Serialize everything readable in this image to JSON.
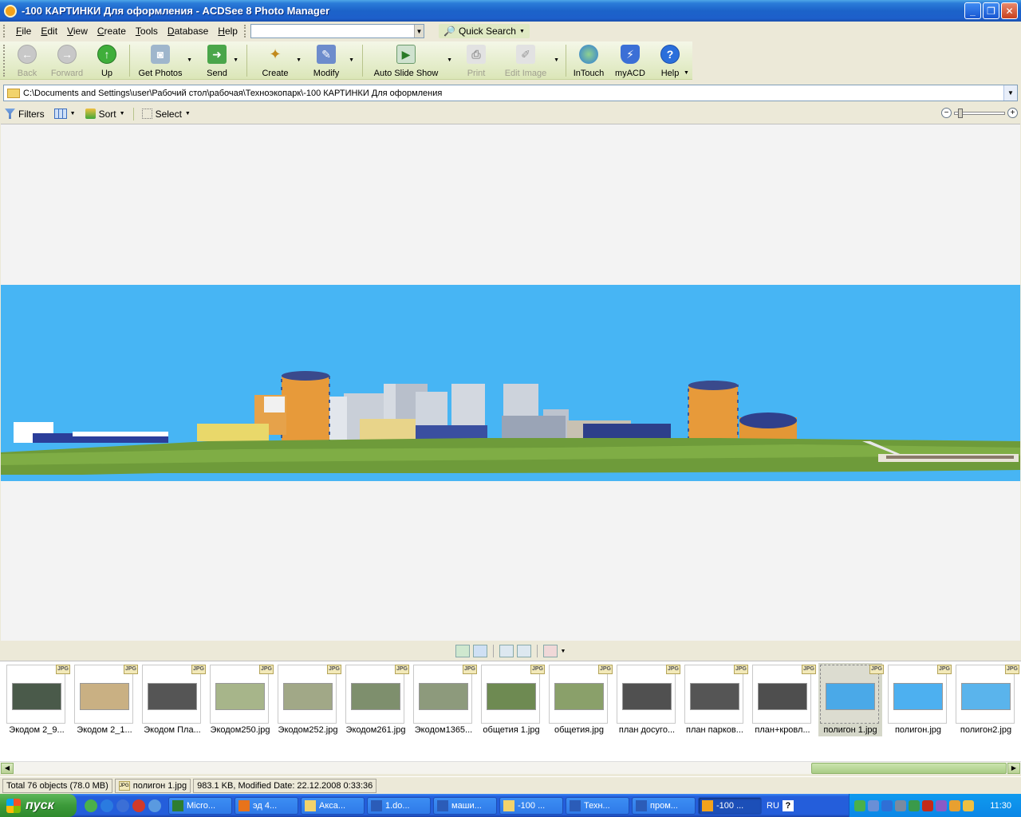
{
  "window": {
    "title": "-100 КАРТИНКИ  Для оформления - ACDSee 8 Photo Manager",
    "buttons": {
      "minimize": "_",
      "maximize": "❐",
      "close": "✕"
    }
  },
  "menu": {
    "items": [
      "File",
      "Edit",
      "View",
      "Create",
      "Tools",
      "Database",
      "Help"
    ],
    "search_value": "",
    "quick_search_label": "Quick Search"
  },
  "toolbar": {
    "buttons": [
      {
        "label": "Back",
        "icon": "back-arrow-icon",
        "enabled": false
      },
      {
        "label": "Forward",
        "icon": "forward-arrow-icon",
        "enabled": false
      },
      {
        "label": "Up",
        "icon": "up-arrow-icon",
        "enabled": true
      },
      {
        "label": "Get Photos",
        "icon": "camera-icon",
        "enabled": true
      },
      {
        "label": "Send",
        "icon": "send-icon",
        "enabled": true
      },
      {
        "label": "Create",
        "icon": "magic-wand-icon",
        "enabled": true
      },
      {
        "label": "Modify",
        "icon": "modify-icon",
        "enabled": true
      },
      {
        "label": "Auto Slide Show",
        "icon": "slideshow-icon",
        "enabled": true
      },
      {
        "label": "Print",
        "icon": "printer-icon",
        "enabled": false
      },
      {
        "label": "Edit Image",
        "icon": "edit-image-icon",
        "enabled": false
      },
      {
        "label": "InTouch",
        "icon": "globe-icon",
        "enabled": true
      },
      {
        "label": "myACD",
        "icon": "myacd-icon",
        "enabled": true
      },
      {
        "label": "Help",
        "icon": "help-icon",
        "enabled": true
      }
    ]
  },
  "address": {
    "path": "C:\\Documents and Settings\\user\\Рабочий стол\\рабочая\\Техноэкопарк\\-100 КАРТИНКИ  Для оформления"
  },
  "filterbar": {
    "filters_label": "Filters",
    "sort_label": "Sort",
    "select_label": "Select"
  },
  "filmstrip": {
    "badge": "JPG",
    "items": [
      {
        "name": "Экодом 2_9...",
        "color": "#4a5a4a"
      },
      {
        "name": "Экодом 2_1...",
        "color": "#c9b083"
      },
      {
        "name": "Экодом Пла...",
        "color": "#555555"
      },
      {
        "name": "Экодом250.jpg",
        "color": "#a7b58a"
      },
      {
        "name": "Экодом252.jpg",
        "color": "#a1a887"
      },
      {
        "name": "Экодом261.jpg",
        "color": "#7e8f6d"
      },
      {
        "name": "Экодом1365...",
        "color": "#8d9a7c"
      },
      {
        "name": "общетия 1.jpg",
        "color": "#6e8a52"
      },
      {
        "name": "общетия.jpg",
        "color": "#8aa06a"
      },
      {
        "name": "план досуго...",
        "color": "#505050"
      },
      {
        "name": "план парков...",
        "color": "#555555"
      },
      {
        "name": "план+кровл...",
        "color": "#4e4e4e"
      },
      {
        "name": "полигон 1.jpg",
        "color": "#4aa9e8",
        "selected": true
      },
      {
        "name": "полигон.jpg",
        "color": "#4db0f0"
      },
      {
        "name": "полигон2.jpg",
        "color": "#5ab4ec"
      }
    ]
  },
  "status": {
    "total": "Total 76 objects  (78.0 MB)",
    "file": "полигон 1.jpg",
    "info": "983.1 KB, Modified Date: 22.12.2008 0:33:36"
  },
  "taskbar": {
    "start_label": "пуск",
    "tasks": [
      {
        "label": "Micro...",
        "icon_color": "#2e7d32"
      },
      {
        "label": "эд 4...",
        "icon_color": "#e8731a"
      },
      {
        "label": "Акса...",
        "icon_color": "#f2d36b"
      },
      {
        "label": "1.do...",
        "icon_color": "#2b5cb8"
      },
      {
        "label": "маши...",
        "icon_color": "#2b5cb8"
      },
      {
        "label": "-100 ...",
        "icon_color": "#f2d36b"
      },
      {
        "label": "Техн...",
        "icon_color": "#2b5cb8"
      },
      {
        "label": "пром...",
        "icon_color": "#2b5cb8"
      },
      {
        "label": "-100 ...",
        "icon_color": "#f3a21b",
        "active": true
      }
    ],
    "language": "RU",
    "clock": "11:30"
  }
}
